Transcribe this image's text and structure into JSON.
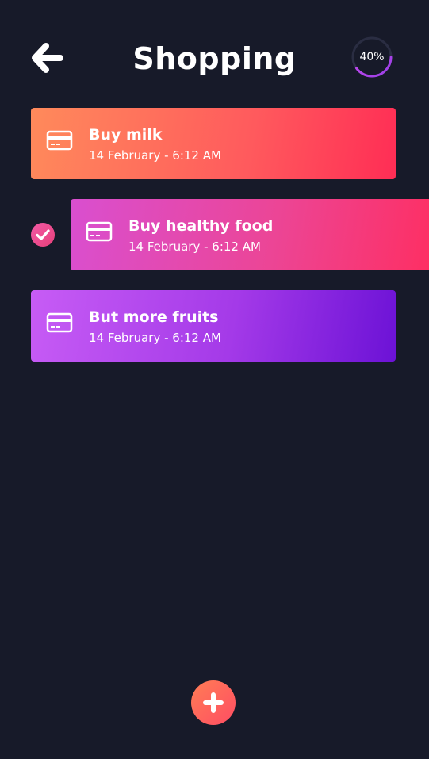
{
  "header": {
    "title": "Shopping",
    "progress": {
      "label": "40%",
      "fraction": 0.4
    }
  },
  "tasks": [
    {
      "title": "Buy milk",
      "date": "14 February - 6:12 AM",
      "completed": false,
      "icon": "credit-card-icon"
    },
    {
      "title": "Buy healthy food",
      "date": "14 February - 6:12 AM",
      "completed": true,
      "icon": "credit-card-icon"
    },
    {
      "title": "But more fruits",
      "date": "14 February - 6:12 AM",
      "completed": false,
      "icon": "credit-card-icon"
    }
  ],
  "icons": {
    "back": "arrow-left-icon",
    "check": "checkmark-icon",
    "add": "plus-icon"
  },
  "colors": {
    "background": "#171a29",
    "progress_track": "#2a2d42",
    "progress_arc": "#b04ae8",
    "task_1": [
      "#ff8a5b",
      "#ff2d55"
    ],
    "task_2": [
      "#d94fd0",
      "#ff2d5f"
    ],
    "task_3": [
      "#c75cf5",
      "#6c12d6"
    ],
    "check": "#ec4b8e",
    "fab": [
      "#ff7d55",
      "#ff4d63"
    ]
  }
}
